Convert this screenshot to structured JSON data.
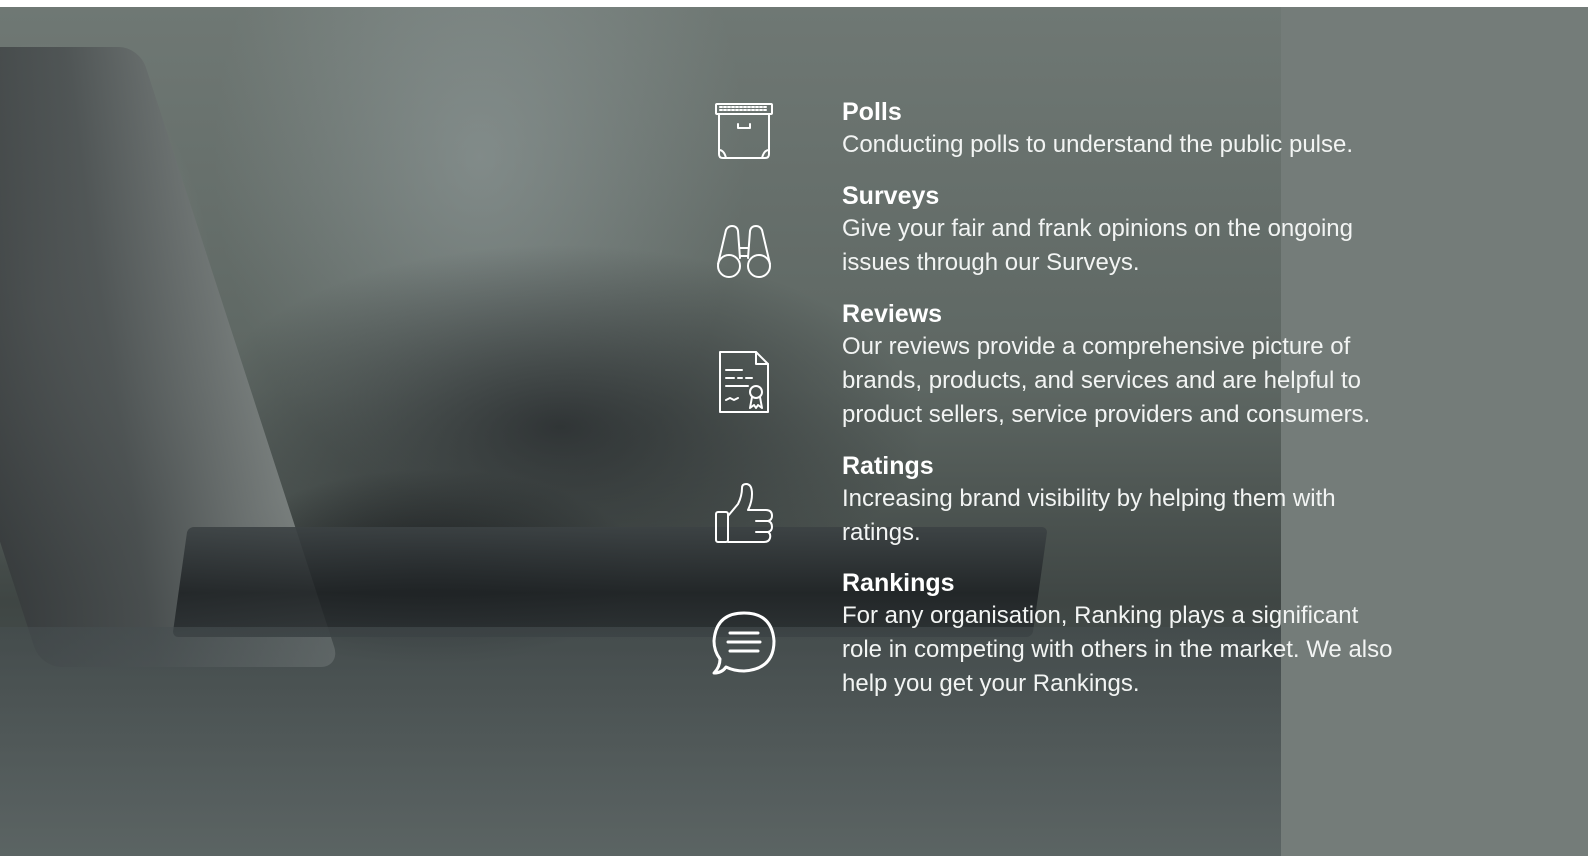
{
  "features": [
    {
      "icon": "archive-box-icon",
      "title": "Polls",
      "description": "Conducting polls to understand the public pulse."
    },
    {
      "icon": "binoculars-icon",
      "title": "Surveys",
      "description": "Give your fair and frank opinions on the ongoing issues through our Surveys."
    },
    {
      "icon": "certificate-document-icon",
      "title": "Reviews",
      "description": "Our reviews provide a comprehensive picture of brands, products, and services and are helpful to product sellers, service providers and consumers."
    },
    {
      "icon": "thumbs-up-icon",
      "title": "Ratings",
      "description": "Increasing brand visibility by helping them with ratings."
    },
    {
      "icon": "chat-bubble-icon",
      "title": "Rankings",
      "description": "For any organisation, Ranking plays a significant role in competing with others in the market. We also help you get your Rankings."
    }
  ],
  "colors": {
    "text": "#ffffff",
    "overlay": "#747c79"
  }
}
